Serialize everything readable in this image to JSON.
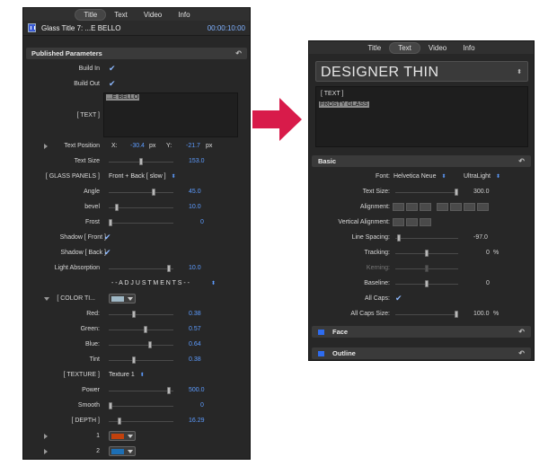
{
  "tabs": [
    "Title",
    "Text",
    "Video",
    "Info"
  ],
  "left": {
    "active_tab": "Title",
    "title": "Glass Title 7: ...E BELLO",
    "timecode": "00:00:10:00",
    "section": "Published Parameters",
    "build_in": "Build In",
    "build_out": "Build Out",
    "text_label": "[ TEXT ]",
    "text_value": "...E BELLO",
    "text_position": "Text Position",
    "x_label": "X:",
    "x_value": "-30.4",
    "px": "px",
    "y_label": "Y:",
    "y_value": "-21.7",
    "text_size": "Text Size",
    "text_size_val": "153.0",
    "glass_panels": "[ GLASS PANELS ]",
    "glass_panels_val": "Front + Back [ slow ]",
    "angle": "Angle",
    "angle_val": "45.0",
    "bevel": "bevel",
    "bevel_val": "10.0",
    "frost": "Frost",
    "frost_val": "0",
    "shadow_front": "Shadow [ Front ]",
    "shadow_back": "Shadow [ Back ]",
    "light_absorption": "Light Absorption",
    "light_absorption_val": "10.0",
    "adjustments": "- - A D J U S T M E N T S - -",
    "color_ti": "[ COLOR  TI...",
    "red": "Red:",
    "red_val": "0.38",
    "green": "Green:",
    "green_val": "0.57",
    "blue": "Blue:",
    "blue_val": "0.64",
    "tint": "Tint",
    "tint_val": "0.38",
    "texture": "[ TEXTURE ]",
    "texture_val": "Texture 1",
    "power": "Power",
    "power_val": "500.0",
    "smooth": "Smooth",
    "smooth_val": "0",
    "depth": "[ DEPTH ]",
    "depth_val": "16.29",
    "item1": "1",
    "item2": "2"
  },
  "right": {
    "active_tab": "Text",
    "font_name": "DESIGNER THIN",
    "text_label": "[ TEXT ]",
    "text_value": "FROSTY GLASS",
    "basic": "Basic",
    "font_label": "Font:",
    "font_family": "Helvetica Neue",
    "font_weight": "UltraLight",
    "text_size_label": "Text Size:",
    "text_size_val": "300.0",
    "alignment_label": "Alignment:",
    "valign_label": "Vertical Alignment:",
    "line_spacing_label": "Line Spacing:",
    "line_spacing_val": "-97.0",
    "tracking_label": "Tracking:",
    "tracking_val": "0",
    "pct": "%",
    "kerning_label": "Kerning:",
    "baseline_label": "Baseline:",
    "baseline_val": "0",
    "all_caps_label": "All Caps:",
    "all_caps_size_label": "All Caps Size:",
    "all_caps_size_val": "100.0",
    "face": "Face",
    "outline": "Outline"
  },
  "colors": {
    "accent": "#5d9cff",
    "arrow": "#d81b4a",
    "swatch1": "#9fb8c6",
    "swatch2": "#c2410c",
    "swatch3": "#1d6fb5"
  }
}
